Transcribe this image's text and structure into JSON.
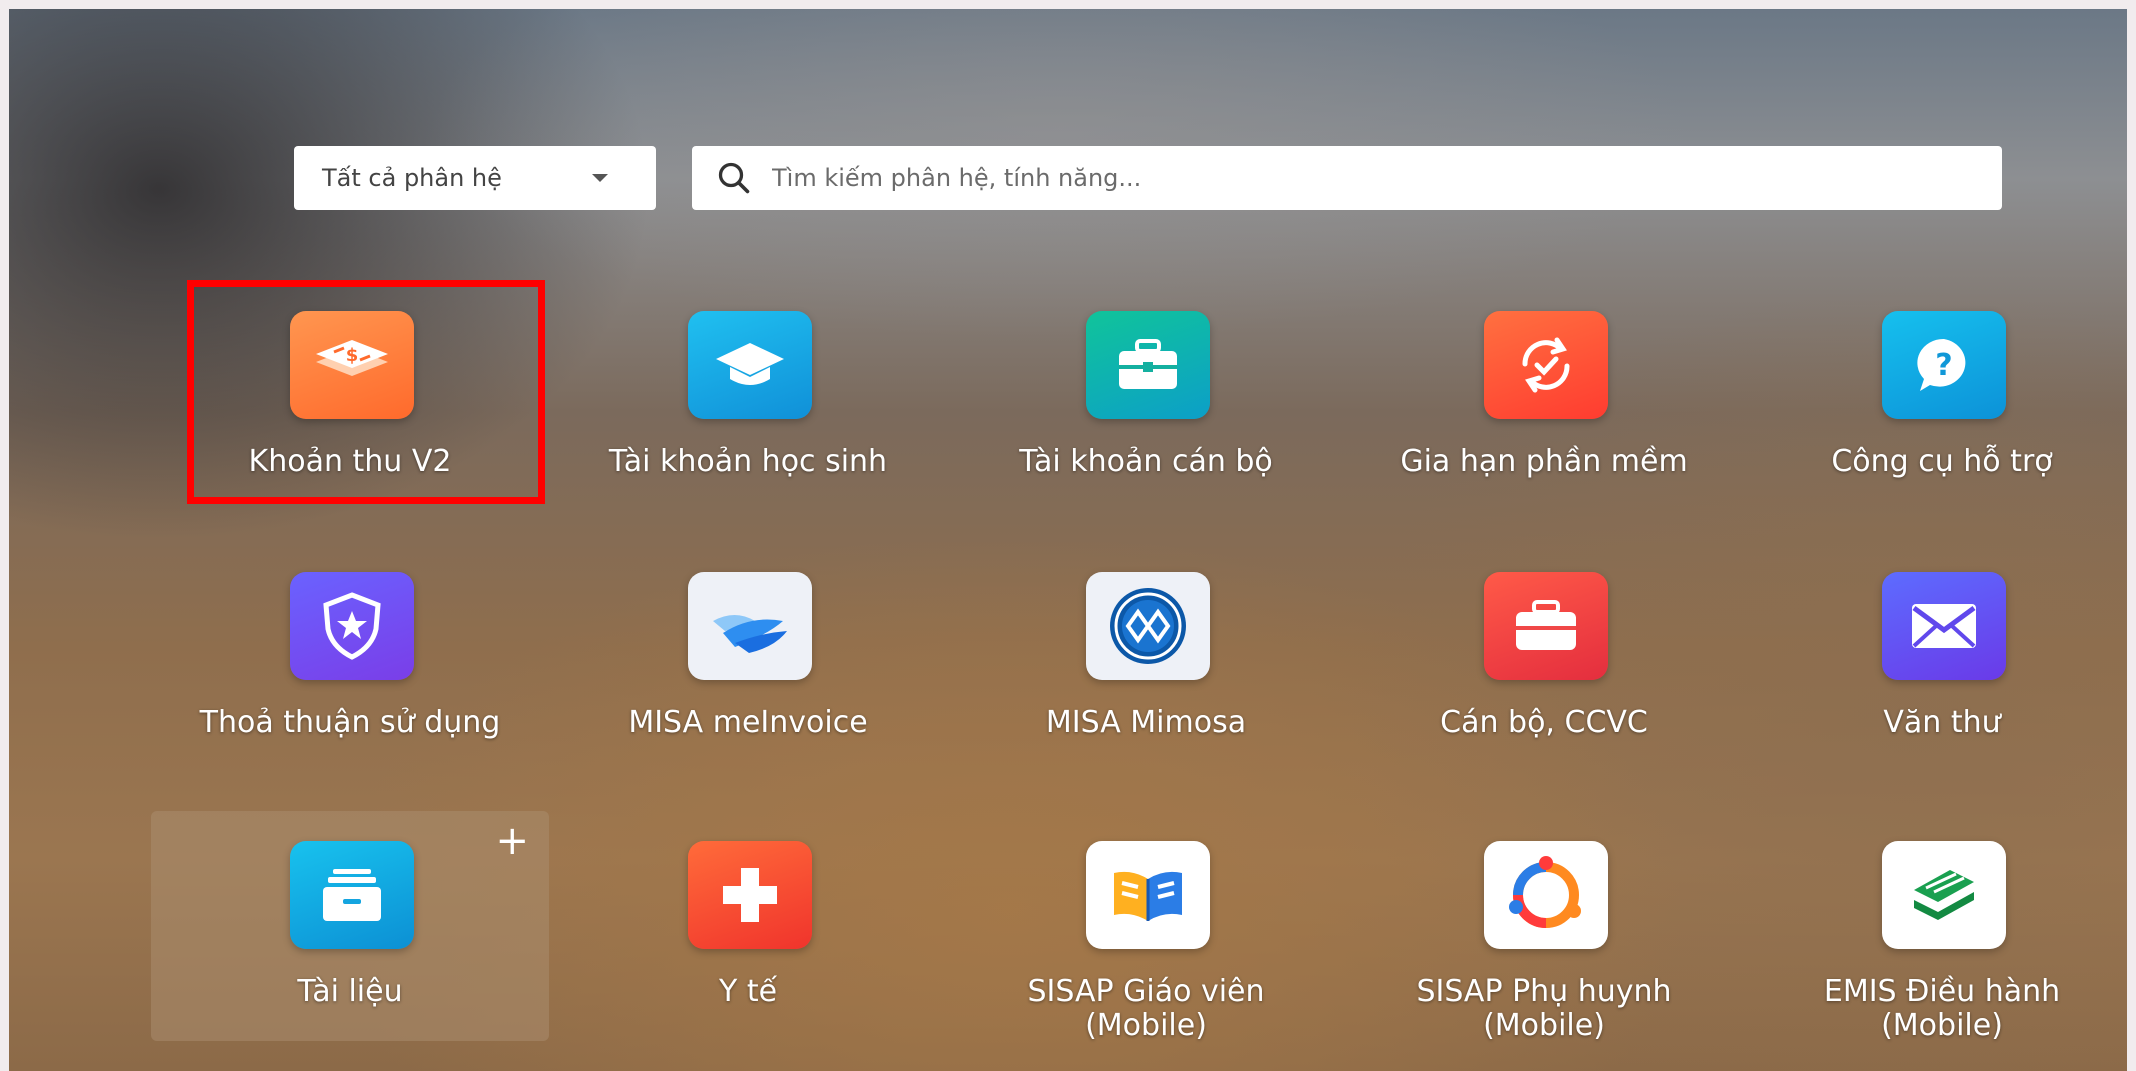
{
  "toolbar": {
    "dropdown_value": "Tất cả phân hệ",
    "search_placeholder": "Tìm kiếm phân hệ, tính năng..."
  },
  "apps": [
    {
      "label": "Khoản thu V2",
      "icon": "dollar-layers-icon",
      "color": "#ff7b3a"
    },
    {
      "label": "Tài khoản học sinh",
      "icon": "graduation-cap-icon",
      "color": "#18a7e6"
    },
    {
      "label": "Tài khoản cán bộ",
      "icon": "briefcase-icon",
      "color": "#16b58f"
    },
    {
      "label": "Gia hạn phần mềm",
      "icon": "refresh-check-icon",
      "color": "#ff5a38"
    },
    {
      "label": "Công cụ hỗ trợ",
      "icon": "help-bubble-icon",
      "color": "#10a9e0"
    },
    {
      "label": "Thoả thuận sử dụng",
      "icon": "shield-star-icon",
      "color": "#6a4cf0"
    },
    {
      "label": "MISA meInvoice",
      "icon": "meinvoice-logo-icon",
      "color": "#e9eef7"
    },
    {
      "label": "MISA Mimosa",
      "icon": "mimosa-logo-icon",
      "color": "#e9eef7"
    },
    {
      "label": "Cán bộ, CCVC",
      "icon": "suitcase-icon",
      "color": "#f04040"
    },
    {
      "label": "Văn thư",
      "icon": "envelope-icon",
      "color": "#5b4ff0"
    },
    {
      "label": "Tài liệu",
      "icon": "archive-box-icon",
      "color": "#14a5e0",
      "add_symbol": "+"
    },
    {
      "label": "Y tế",
      "icon": "medical-cross-icon",
      "color": "#ff4a30"
    },
    {
      "label": "SISAP Giáo viên",
      "label2": "(Mobile)",
      "icon": "open-book-icon",
      "color": "#ffffff"
    },
    {
      "label": "SISAP Phụ huynh",
      "label2": "(Mobile)",
      "icon": "family-circle-icon",
      "color": "#ffffff"
    },
    {
      "label": "EMIS Điều hành",
      "label2": "(Mobile)",
      "icon": "emis-layers-icon",
      "color": "#ffffff"
    }
  ]
}
